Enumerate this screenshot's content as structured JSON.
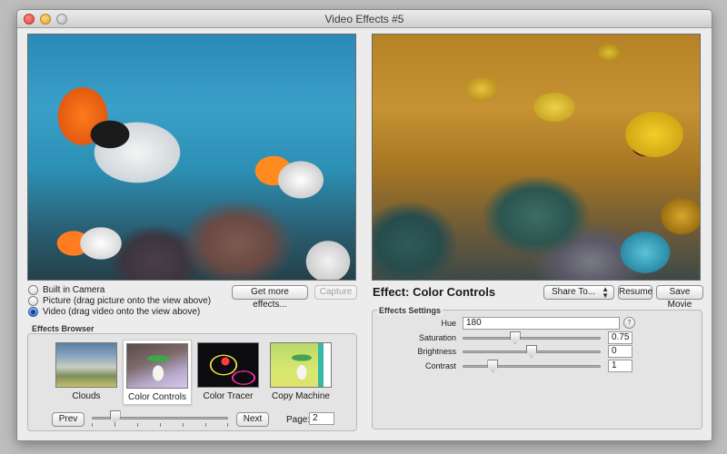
{
  "window": {
    "title": "Video Effects #5"
  },
  "source": {
    "options": [
      {
        "label": "Built in Camera",
        "selected": false
      },
      {
        "label": "Picture (drag picture onto the view above)",
        "selected": false
      },
      {
        "label": "Video (drag video onto the view above)",
        "selected": true
      }
    ],
    "get_more_label": "Get more effects...",
    "capture_label": "Capture"
  },
  "browser": {
    "title": "Effects Browser",
    "thumbs": [
      {
        "label": "Clouds",
        "icon": "clouds-thumbnail",
        "selected": false
      },
      {
        "label": "Color Controls",
        "icon": "color-controls-thumbnail",
        "selected": true
      },
      {
        "label": "Color Tracer",
        "icon": "color-tracer-thumbnail",
        "selected": false
      },
      {
        "label": "Copy Machine",
        "icon": "copy-machine-thumbnail",
        "selected": false
      }
    ],
    "prev_label": "Prev",
    "next_label": "Next",
    "page_label": "Page:",
    "page_value": "2",
    "slider_position": 0.17
  },
  "effect": {
    "prefix": "Effect:",
    "name": "Color Controls",
    "share_label": "Share To...",
    "resume_label": "Resume",
    "save_label": "Save Movie",
    "settings_title": "Effects Settings",
    "settings": {
      "hue": {
        "label": "Hue",
        "value": "180"
      },
      "saturation": {
        "label": "Saturation",
        "value": "0.75",
        "slider": 0.38
      },
      "brightness": {
        "label": "Brightness",
        "value": "0",
        "slider": 0.5
      },
      "contrast": {
        "label": "Contrast",
        "value": "1",
        "slider": 0.22
      }
    }
  }
}
